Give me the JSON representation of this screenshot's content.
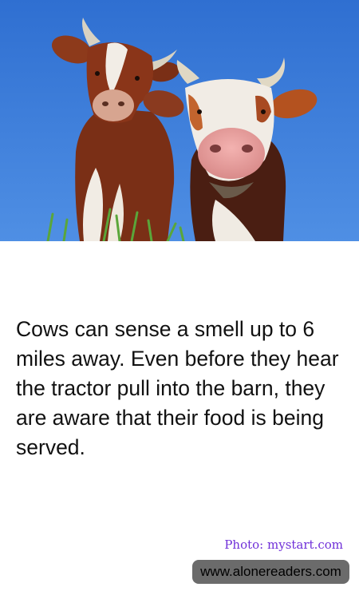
{
  "image": {
    "subject": "two-cows-photo"
  },
  "fact": {
    "text": "Cows can sense a smell up to 6 miles away. Even before they hear the tractor pull into the barn, they are aware that their food is being served."
  },
  "credit": {
    "text": "Photo: mystart.com"
  },
  "watermark": {
    "text": "www.alonereaders.com"
  },
  "colors": {
    "sky": "#3d78d6",
    "credit": "#6f2fd8",
    "badge": "#6b6b6b"
  }
}
